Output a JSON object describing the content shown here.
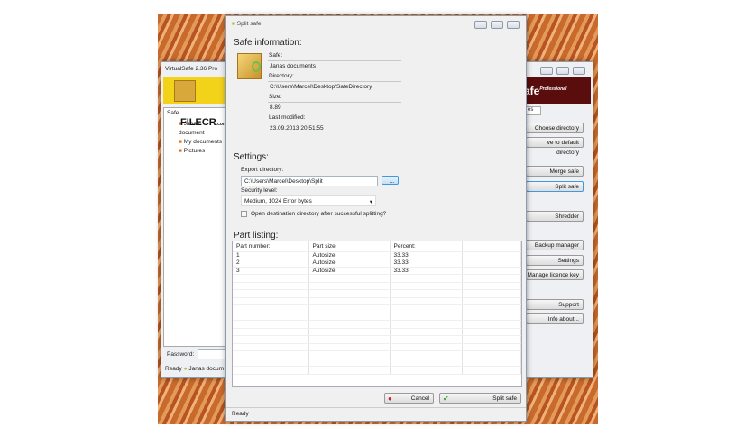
{
  "back_window": {
    "title": "VirtualSafe 2.36 Pro",
    "logo_text": "afe",
    "logo_sup": "Professional",
    "tab": "es",
    "tree_root": "Safe",
    "tree_items": [
      "Janas document",
      "My documents",
      "Pictures"
    ],
    "buttons": [
      "Choose directory",
      "ve to default directory",
      "Merge safe",
      "Split safe",
      "Shredder",
      "Backup manager",
      "Settings",
      "Manage licence key",
      "Support",
      "Info about..."
    ],
    "password_label": "Password:",
    "status": "Ready",
    "status_safe": "Janas docum"
  },
  "watermark": {
    "text": "FILECR",
    "sub": ".com"
  },
  "dialog": {
    "title": "Split safe",
    "safe_info_heading": "Safe information:",
    "safe_label": "Safe:",
    "safe_value": "Janas documents",
    "directory_label": "Directory:",
    "directory_value": "C:\\Users\\Marcel\\Desktop\\SafeDirectory",
    "size_label": "Size:",
    "size_value": "8.89",
    "modified_label": "Last modified:",
    "modified_value": "23.09.2013 20:51:55",
    "settings_heading": "Settings:",
    "export_label": "Export directory:",
    "export_value": "C:\\Users\\Marcel\\Desktop\\Split",
    "browse_label": "...",
    "security_label": "Security level:",
    "security_value": "Medium, 1024 Error bytes",
    "open_checkbox_label": "Open destination directory after successful splitting?",
    "open_checked": false,
    "part_heading": "Part listing:",
    "columns": [
      "Part number:",
      "Part size:",
      "Percent:",
      ""
    ],
    "rows": [
      [
        "1",
        "Autosize",
        "33.33"
      ],
      [
        "2",
        "Autosize",
        "33.33"
      ],
      [
        "3",
        "Autosize",
        "33.33"
      ]
    ],
    "cancel_label": "Cancel",
    "split_label": "Split safe",
    "status": "Ready"
  }
}
